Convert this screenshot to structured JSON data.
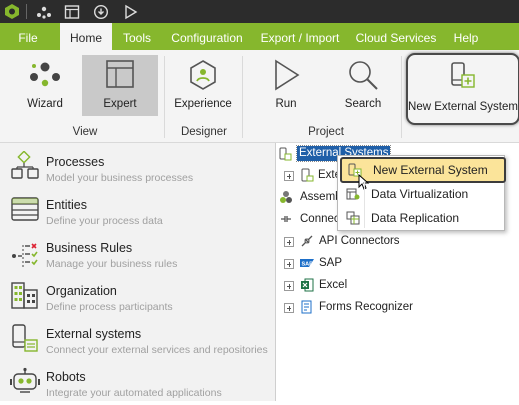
{
  "menubar": {
    "items": [
      "File",
      "Home",
      "Tools",
      "Configuration",
      "Export / Import",
      "Cloud Services",
      "Help"
    ],
    "active": "Home"
  },
  "ribbon": {
    "buttons": {
      "wizard": "Wizard",
      "expert": "Expert",
      "experience": "Experience",
      "run": "Run",
      "search": "Search",
      "new_external_system": "New External System"
    },
    "groups": {
      "view": "View",
      "designer": "Designer",
      "project": "Project"
    }
  },
  "left_panel": {
    "items": [
      {
        "title": "Processes",
        "subtitle": "Model your business processes",
        "icon": "processes-icon"
      },
      {
        "title": "Entities",
        "subtitle": "Define your process data",
        "icon": "entities-icon"
      },
      {
        "title": "Business Rules",
        "subtitle": "Manage your business rules",
        "icon": "business-rules-icon"
      },
      {
        "title": "Organization",
        "subtitle": "Define process participants",
        "icon": "organization-icon"
      },
      {
        "title": "External systems",
        "subtitle": "Connect your external services and repositories",
        "icon": "external-systems-icon"
      },
      {
        "title": "Robots",
        "subtitle": "Integrate your automated applications",
        "icon": "robots-icon"
      }
    ]
  },
  "tree": {
    "root": "External Systems",
    "items": [
      {
        "label": "Exte",
        "icon": "external-system-icon"
      },
      {
        "label": "Assemb",
        "icon": "assemblies-icon"
      },
      {
        "label": "Connec",
        "icon": "connectors-icon"
      },
      {
        "label": "API Connectors",
        "icon": "api-connectors-icon"
      },
      {
        "label": "SAP",
        "icon": "sap-icon"
      },
      {
        "label": "Excel",
        "icon": "excel-icon"
      },
      {
        "label": "Forms Recognizer",
        "icon": "forms-recognizer-icon"
      }
    ]
  },
  "context_menu": {
    "items": [
      {
        "label": "New External System",
        "icon": "new-external-system-icon"
      },
      {
        "label": "Data Virtualization",
        "icon": "data-virtualization-icon"
      },
      {
        "label": "Data Replication",
        "icon": "data-replication-icon"
      }
    ]
  },
  "colors": {
    "titlebar": "#2c2c2c",
    "menubar": "#86b72d",
    "ribbon_bg": "#f4f4f4",
    "left_panel_bg": "#f2f2f2",
    "highlight": "#fbe49a",
    "tree_selected": "#1f5fa8"
  }
}
